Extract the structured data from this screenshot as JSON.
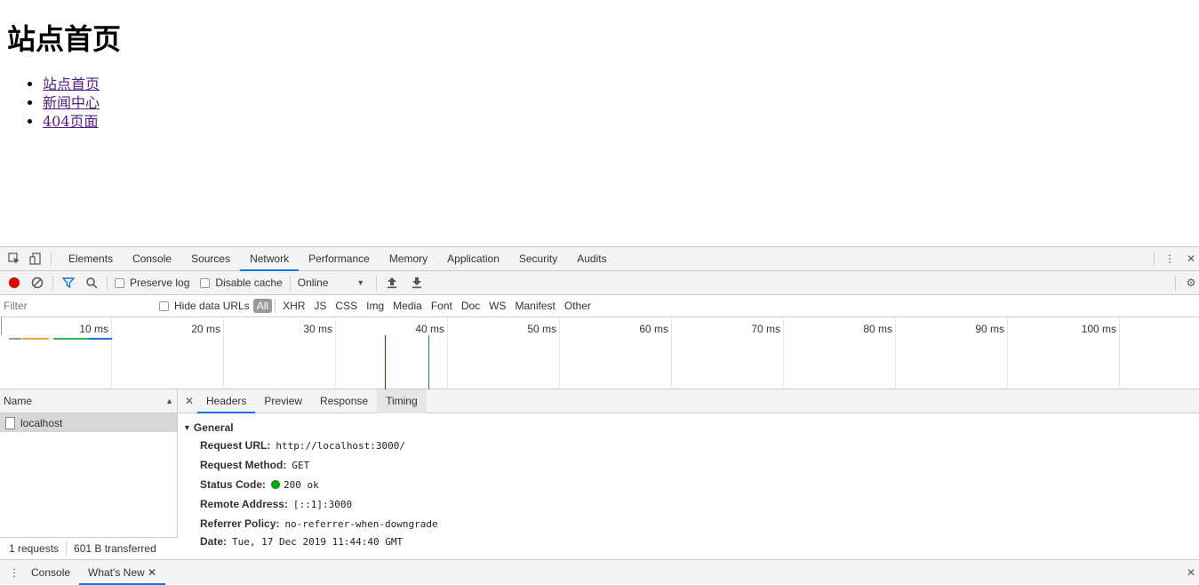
{
  "page": {
    "title": "站点首页",
    "links": [
      "站点首页",
      "新闻中心",
      "404页面"
    ]
  },
  "devtools": {
    "tabs": [
      "Elements",
      "Console",
      "Sources",
      "Network",
      "Performance",
      "Memory",
      "Application",
      "Security",
      "Audits"
    ],
    "active_tab": "Network",
    "toolbar": {
      "preserve_log": "Preserve log",
      "disable_cache": "Disable cache",
      "throttle": "Online"
    },
    "filterbar": {
      "filter_placeholder": "Filter",
      "hide_data_urls": "Hide data URLs",
      "types": [
        "All",
        "XHR",
        "JS",
        "CSS",
        "Img",
        "Media",
        "Font",
        "Doc",
        "WS",
        "Manifest",
        "Other"
      ]
    },
    "timeline": {
      "ticks": [
        "10 ms",
        "20 ms",
        "30 ms",
        "40 ms",
        "50 ms",
        "60 ms",
        "70 ms",
        "80 ms",
        "90 ms",
        "100 ms"
      ],
      "dom_content_loaded_color": "#1a73e8",
      "load_color": "#b22222"
    },
    "requests": {
      "column_name": "Name",
      "rows": [
        "localhost"
      ],
      "summary": "1 requests",
      "transferred": "601 B transferred"
    },
    "details": {
      "tabs": [
        "Headers",
        "Preview",
        "Response",
        "Timing"
      ],
      "active_tab": "Headers",
      "section": "General",
      "fields": [
        {
          "key": "Request URL:",
          "value": "http://localhost:3000/"
        },
        {
          "key": "Request Method:",
          "value": "GET"
        },
        {
          "key": "Status Code:",
          "value": "200 ok"
        },
        {
          "key": "Remote Address:",
          "value": "[::1]:3000"
        },
        {
          "key": "Referrer Policy:",
          "value": "no-referrer-when-downgrade"
        },
        {
          "key": "Date:",
          "value": "Tue, 17 Dec 2019 11:44:40 GMT"
        }
      ]
    },
    "drawer": {
      "tabs": [
        "Console",
        "What's New"
      ]
    }
  }
}
